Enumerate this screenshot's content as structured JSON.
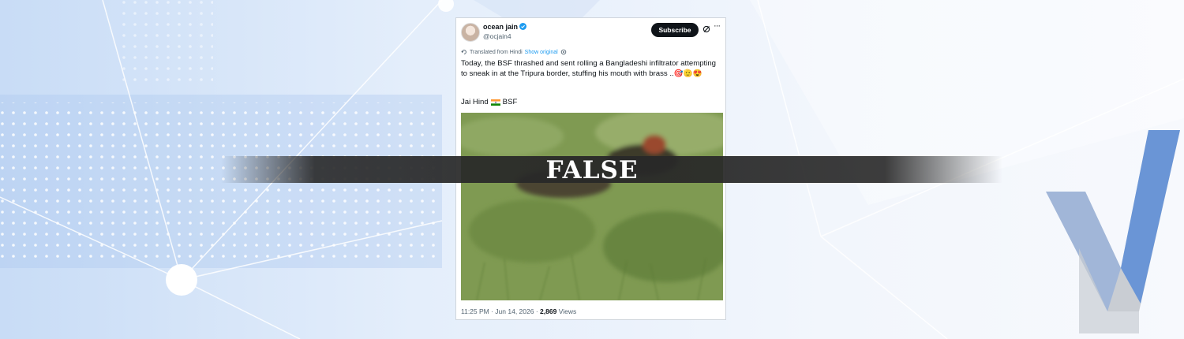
{
  "tweet": {
    "author_name": "ocean jain",
    "author_handle": "@ocjain4",
    "subscribe_label": "Subscribe",
    "more_icon": "···",
    "translated_label": "Translated from Hindi",
    "show_original_label": "Show original",
    "text": "Today, the BSF thrashed and sent rolling a Bangladeshi infiltrator attempting to sneak in at the Tripura border, stuffing his mouth with brass ..🎯🫡😍",
    "line2_prefix": "Jai Hind",
    "line2_suffix": "BSF",
    "timestamp": "11:25 PM · Jun 14, 2026 ·",
    "views_count": "2,869",
    "views_label": "Views"
  },
  "verdict": "FALSE",
  "colors": {
    "accent": "#1d9bf0",
    "subscribe_bg": "#0f1419",
    "logo_blue": "#5f8fd6",
    "logo_grey": "#c9cdd3"
  },
  "icons": [
    "verified-badge-icon",
    "grok-icon",
    "more-icon",
    "translate-icon",
    "settings-icon",
    "india-flag-icon",
    "brand-logo-icon"
  ]
}
